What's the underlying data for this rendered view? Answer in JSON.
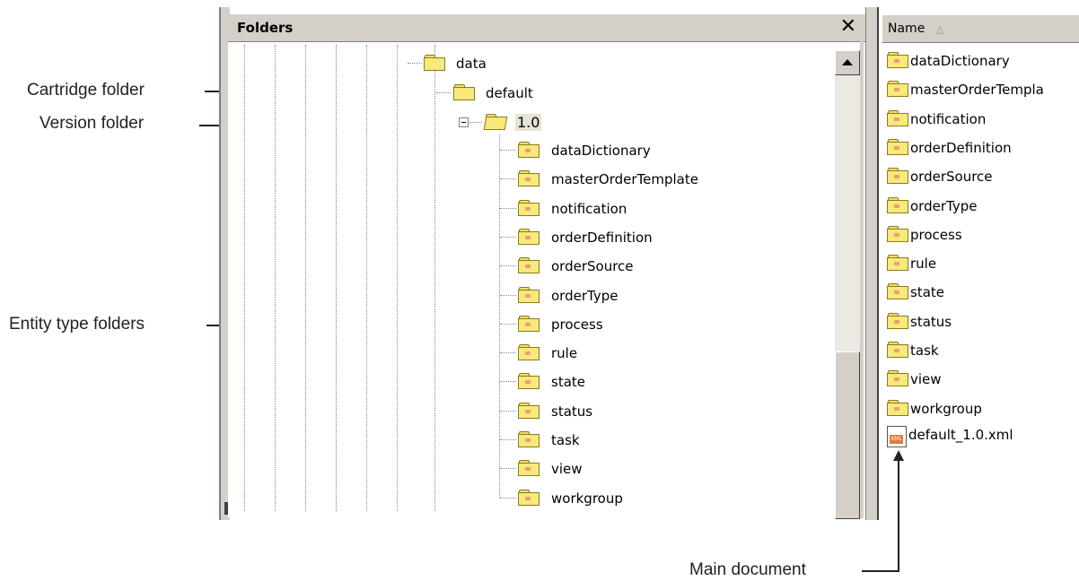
{
  "callouts": {
    "cartridge": "Cartridge folder",
    "version": "Version folder",
    "entity": "Entity type folders",
    "main_doc": "Main document"
  },
  "folders_pane": {
    "title": "Folders",
    "close_icon": "close-icon",
    "tree": {
      "data": "data",
      "default": "default",
      "version": "1.0",
      "children": [
        "dataDictionary",
        "masterOrderTemplate",
        "notification",
        "orderDefinition",
        "orderSource",
        "orderType",
        "process",
        "rule",
        "state",
        "status",
        "task",
        "view",
        "workgroup"
      ]
    }
  },
  "list_pane": {
    "column_header": "Name",
    "sort_icon": "sort-ascending-icon",
    "items": [
      "dataDictionary",
      "masterOrderTempla",
      "notification",
      "orderDefinition",
      "orderSource",
      "orderType",
      "process",
      "rule",
      "state",
      "status",
      "task",
      "view",
      "workgroup"
    ],
    "file": "default_1.0.xml"
  }
}
